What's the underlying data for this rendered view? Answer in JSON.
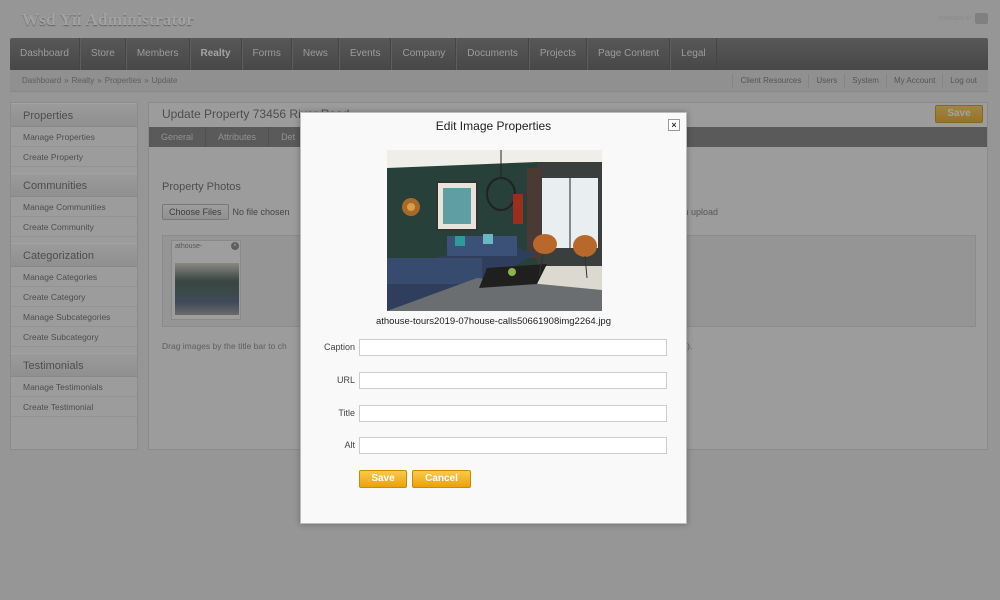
{
  "app": {
    "title": "Wsd Yii Administrator",
    "powered_by": "POWERED BY"
  },
  "main_nav": [
    {
      "label": "Dashboard"
    },
    {
      "label": "Store"
    },
    {
      "label": "Members"
    },
    {
      "label": "Realty"
    },
    {
      "label": "Forms"
    },
    {
      "label": "News"
    },
    {
      "label": "Events"
    },
    {
      "label": "Company"
    },
    {
      "label": "Documents"
    },
    {
      "label": "Projects"
    },
    {
      "label": "Page Content"
    },
    {
      "label": "Legal"
    }
  ],
  "breadcrumb": [
    "Dashboard",
    "»",
    "Realty",
    "»",
    "Properties",
    "»",
    "Update"
  ],
  "top_links": [
    "Client Resources",
    "Users",
    "System",
    "My Account",
    "Log out"
  ],
  "sidebar": {
    "sections": [
      {
        "title": "Properties",
        "items": [
          "Manage Properties",
          "Create Property"
        ]
      },
      {
        "title": "Communities",
        "items": [
          "Manage Communities",
          "Create Community"
        ]
      },
      {
        "title": "Categorization",
        "items": [
          "Manage Categories",
          "Create Category",
          "Manage Subcategories",
          "Create Subcategory"
        ]
      },
      {
        "title": "Testimonials",
        "items": [
          "Manage Testimonials",
          "Create Testimonial"
        ]
      }
    ]
  },
  "content": {
    "title": "Update Property 73456 River Road",
    "save_label": "Save",
    "tabs": [
      "General",
      "Attributes",
      "Det"
    ],
    "photos_label": "Property Photos",
    "choose_files": "Choose Files",
    "no_file": "No file chosen",
    "batch_text": "ch upload",
    "thumb_title": "athouse-",
    "drag_text": "Drag images by the title bar to ch",
    "optional_text": "onal)."
  },
  "modal": {
    "title": "Edit Image Properties",
    "close_glyph": "×",
    "filename": "athouse-tours2019-07house-calls50661908img2264.jpg",
    "fields": [
      {
        "label": "Caption",
        "value": ""
      },
      {
        "label": "URL",
        "value": ""
      },
      {
        "label": "Title",
        "value": ""
      },
      {
        "label": "Alt",
        "value": ""
      }
    ],
    "save_label": "Save",
    "cancel_label": "Cancel"
  }
}
